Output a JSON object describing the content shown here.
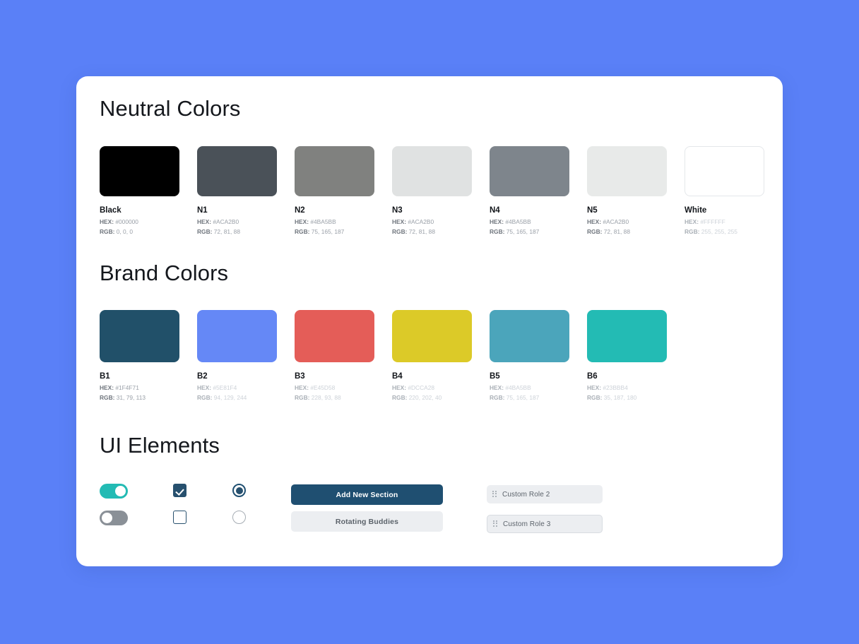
{
  "background_color": "#5A80F7",
  "card": {
    "background_color": "#FFFFFF"
  },
  "sections": {
    "neutral": {
      "title": "Neutral Colors"
    },
    "brand": {
      "title": "Brand Colors"
    },
    "ui": {
      "title": "UI Elements"
    }
  },
  "labels": {
    "hex_key": "HEX:",
    "rgb_key": "RGB:"
  },
  "neutral_colors": [
    {
      "name": "Black",
      "hex": "#000000",
      "rgb": "0, 0, 0",
      "swatch": "#000000",
      "faint": false
    },
    {
      "name": "N1",
      "hex": "#ACA2B0",
      "rgb": "72, 81, 88",
      "swatch": "#4A5158",
      "faint": false
    },
    {
      "name": "N2",
      "hex": "#4BA5BB",
      "rgb": "75, 165, 187",
      "swatch": "#80817F",
      "faint": false
    },
    {
      "name": "N3",
      "hex": "#ACA2B0",
      "rgb": "72, 81, 88",
      "swatch": "#E0E2E2",
      "faint": false
    },
    {
      "name": "N4",
      "hex": "#4BA5BB",
      "rgb": "75, 165, 187",
      "swatch": "#7E858C",
      "faint": false
    },
    {
      "name": "N5",
      "hex": "#ACA2B0",
      "rgb": "72, 81, 88",
      "swatch": "#E8EAE9",
      "faint": false
    },
    {
      "name": "White",
      "hex": "#FFFFFF",
      "rgb": "255, 255, 255",
      "swatch": "#FFFFFF",
      "faint": true
    }
  ],
  "brand_colors": [
    {
      "name": "B1",
      "hex": "#1F4F71",
      "rgb": "31, 79, 113",
      "swatch": "#215069",
      "faint": false
    },
    {
      "name": "B2",
      "hex": "#5E81F4",
      "rgb": "94, 129, 244",
      "swatch": "#6588F6",
      "faint": true
    },
    {
      "name": "B3",
      "hex": "#E45D58",
      "rgb": "228, 93, 88",
      "swatch": "#E45D58",
      "faint": true
    },
    {
      "name": "B4",
      "hex": "#DCCA28",
      "rgb": "220, 202, 40",
      "swatch": "#DCCA28",
      "faint": true
    },
    {
      "name": "B5",
      "hex": "#4BA5BB",
      "rgb": "75, 165, 187",
      "swatch": "#4BA5BB",
      "faint": true
    },
    {
      "name": "B6",
      "hex": "#23BBB4",
      "rgb": "35, 187, 180",
      "swatch": "#23BBB4",
      "faint": true
    }
  ],
  "ui_elements": {
    "toggle_on": {
      "state": "on",
      "color": "#23BBB4"
    },
    "toggle_off": {
      "state": "off",
      "color": "#8A9097"
    },
    "checkbox_checked": {
      "state": "checked",
      "color": "#27506E"
    },
    "checkbox_unchecked": {
      "state": "unchecked",
      "color": "#27506E"
    },
    "radio_selected": {
      "state": "selected",
      "color": "#1F4F71"
    },
    "radio_unselected": {
      "state": "unselected",
      "color": "#A6ADB4"
    },
    "primary_button": {
      "label": "Add New Section",
      "color": "#1F4F71"
    },
    "secondary_button": {
      "label": "Rotating Buddies",
      "color": "#ECEEF1"
    },
    "roles": [
      {
        "label": "Custom Role 2"
      },
      {
        "label": "Custom Role 3"
      }
    ]
  }
}
